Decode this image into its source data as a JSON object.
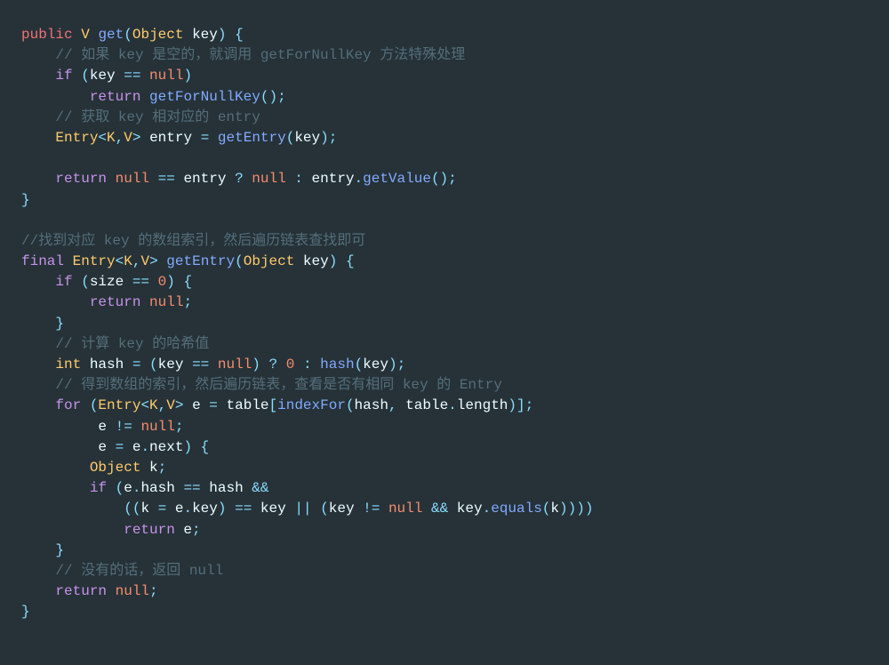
{
  "code": {
    "line1": {
      "kw_public": "public",
      "type_V": "V",
      "fn_get": "get",
      "popen": "(",
      "type_Object": "Object",
      "param_key": " key",
      "pclose": ")",
      "brace": " {"
    },
    "line2": {
      "comment": "// 如果 key 是空的，就调用 getForNullKey 方法特殊处理"
    },
    "line3": {
      "kw_if": "if",
      "popen": " (",
      "ident": "key ",
      "op": "==",
      "sp": " ",
      "null": "null",
      "pclose": ")"
    },
    "line4": {
      "kw_return": "return",
      "sp": " ",
      "fn": "getForNullKey",
      "popen": "(",
      "pclose": ")",
      "semi": ";"
    },
    "line5": {
      "comment": "// 获取 key 相对应的 entry"
    },
    "line6": {
      "type_Entry": "Entry",
      "lt": "<",
      "K": "K",
      "comma": ",",
      "V": "V",
      "gt": ">",
      "ident": " entry ",
      "eq": "=",
      "sp": " ",
      "fn": "getEntry",
      "popen": "(",
      "arg": "key",
      "pclose": ")",
      "semi": ";"
    },
    "line8": {
      "kw_return": "return",
      "sp": " ",
      "null": "null",
      "sp2": " ",
      "op_eq": "==",
      "sp3": " entry ",
      "q": "?",
      "sp4": " ",
      "null2": "null",
      "sp5": " ",
      "colon": ":",
      "sp6": " entry",
      "dot": ".",
      "fn": "getValue",
      "popen": "(",
      "pclose": ")",
      "semi": ";"
    },
    "line9": {
      "brace": "}"
    },
    "line11": {
      "comment": "//找到对应 key 的数组索引，然后遍历链表查找即可"
    },
    "line12": {
      "kw_final": "final",
      "sp": " ",
      "type_Entry": "Entry",
      "lt": "<",
      "K": "K",
      "comma": ",",
      "V": "V",
      "gt": ">",
      "sp2": " ",
      "fn": "getEntry",
      "popen": "(",
      "type_Object": "Object",
      "param": " key",
      "pclose": ")",
      "brace": " {"
    },
    "line13": {
      "kw_if": "if",
      "popen": " (",
      "ident": "size ",
      "op": "==",
      "sp": " ",
      "num": "0",
      "pclose": ")",
      "brace": " {"
    },
    "line14": {
      "kw_return": "return",
      "sp": " ",
      "null": "null",
      "semi": ";"
    },
    "line15": {
      "brace": "}"
    },
    "line16": {
      "comment": "// 计算 key 的哈希值"
    },
    "line17": {
      "type_int": "int",
      "ident": " hash ",
      "eq": "=",
      "sp": " ",
      "popen": "(",
      "ident2": "key ",
      "op": "==",
      "sp2": " ",
      "null": "null",
      "pclose": ")",
      "sp3": " ",
      "q": "?",
      "sp4": " ",
      "num": "0",
      "sp5": " ",
      "colon": ":",
      "sp6": " ",
      "fn": "hash",
      "popen2": "(",
      "arg": "key",
      "pclose2": ")",
      "semi": ";"
    },
    "line18": {
      "comment": "// 得到数组的索引，然后遍历链表，查看是否有相同 key 的 Entry"
    },
    "line19": {
      "kw_for": "for",
      "popen": " (",
      "type_Entry": "Entry",
      "lt": "<",
      "K": "K",
      "comma": ",",
      "V": "V",
      "gt": ">",
      "ident": " e ",
      "eq": "=",
      "sp": " table",
      "br_open": "[",
      "fn": "indexFor",
      "popen2": "(",
      "arg1": "hash",
      "comma2": ",",
      "sp2": " table",
      "dot": ".",
      "ident2": "length",
      "pclose2": ")",
      "br_close": "]",
      "semi": ";"
    },
    "line20": {
      "ident": "e ",
      "op": "!=",
      "sp": " ",
      "null": "null",
      "semi": ";"
    },
    "line21": {
      "ident": "e ",
      "eq": "=",
      "ident2": " e",
      "dot": ".",
      "ident3": "next",
      "pclose": ")",
      "brace": " {"
    },
    "line22": {
      "type_Object": "Object",
      "ident": " k",
      "semi": ";"
    },
    "line23": {
      "kw_if": "if",
      "popen": " (",
      "ident": "e",
      "dot": ".",
      "ident2": "hash ",
      "op": "==",
      "sp": " hash ",
      "op_and": "&&"
    },
    "line24": {
      "popen": "(",
      "popen2": "(",
      "ident": "k ",
      "eq": "=",
      "ident2": " e",
      "dot": ".",
      "ident3": "key",
      "pclose": ")",
      "sp": " ",
      "op": "==",
      "sp2": " key ",
      "op_or": "||",
      "sp3": " ",
      "popen3": "(",
      "ident4": "key ",
      "op_ne": "!=",
      "sp4": " ",
      "null": "null",
      "sp5": " ",
      "op_and": "&&",
      "sp6": " key",
      "dot2": ".",
      "fn": "equals",
      "popen4": "(",
      "arg": "k",
      "pclose4": ")",
      "pclose3": ")",
      "pclose2": ")",
      "pclose_outer": ")"
    },
    "line25": {
      "kw_return": "return",
      "ident": " e",
      "semi": ";"
    },
    "line26": {
      "brace": "}"
    },
    "line27": {
      "comment": "// 没有的话，返回 null"
    },
    "line28": {
      "kw_return": "return",
      "sp": " ",
      "null": "null",
      "semi": ";"
    },
    "line29": {
      "brace": "}"
    }
  }
}
